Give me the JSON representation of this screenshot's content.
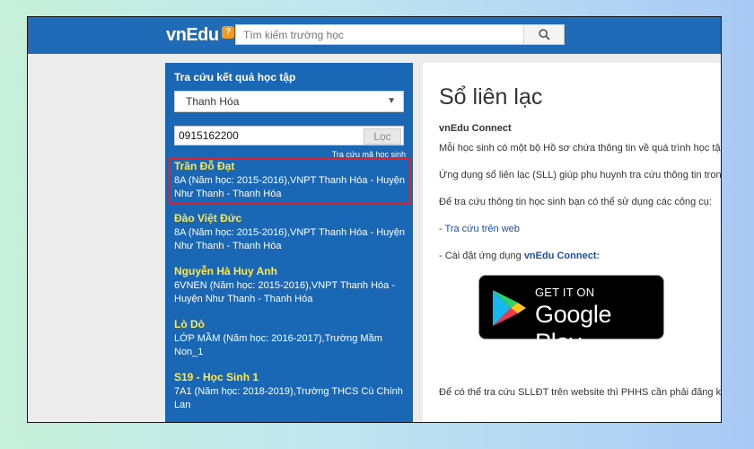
{
  "header": {
    "logo_text": "vnEdu",
    "logo_badge": "?",
    "search_placeholder": "Tìm kiếm trường học"
  },
  "sidebar": {
    "title": "Tra cứu kết quả học tập",
    "province_select": "Thanh Hóa",
    "phone_value": "0915162200",
    "search_button": "Lọc",
    "lookup_link": "Tra cứu mã học sinh",
    "results": [
      {
        "name": "Trần Đỗ Đạt",
        "line1": "8A (Năm học: 2015-2016),VNPT Thanh Hóa - Huyện",
        "line2": "Như Thanh - Thanh Hóa"
      },
      {
        "name": "Đào Việt Đức",
        "line1": "8A (Năm học: 2015-2016),VNPT Thanh Hóa - Huyện",
        "line2": "Như Thanh - Thanh Hóa"
      },
      {
        "name": "Nguyễn Hà Huy Anh",
        "line1": "6VNEN (Năm học: 2015-2016),VNPT Thanh Hóa -",
        "line2": "Huyện Như Thanh - Thanh Hóa"
      },
      {
        "name": "Lò Dò",
        "line1": "LỚP MẦM (Năm học: 2016-2017),Trường Mầm",
        "line2": "Non_1"
      },
      {
        "name": "S19 - Học Sinh 1",
        "line1": "7A1 (Năm học: 2018-2019),Trường THCS Cù Chính",
        "line2": "Lan"
      }
    ]
  },
  "main": {
    "title": "Sổ liên lạc",
    "subtitle": "vnEdu Connect",
    "para1": "Mỗi học sinh có một bộ Hồ sơ chứa thông tin về quá trình học tập",
    "para2": "Ứng dụng sổ liên lạc (SLL) giúp phụ huynh tra cứu thông tin trong",
    "para3": "Để tra cứu thông tin học sinh bạn có thể sử dụng các công cụ:",
    "link1_prefix": "- ",
    "link1": "Tra cứu trên web",
    "app_prefix": "- Cài đặt ứng dụng ",
    "app_name": "vnEdu Connect:",
    "gplay_small": "GET IT ON",
    "gplay_big": "Google Play",
    "footer": "Để có thể tra cứu SLLĐT trên website thì PHHS cần phải đăng ký"
  },
  "colors": {
    "header_blue": "#1f6bb8",
    "sidebar_blue": "#1a67b5",
    "name_yellow": "#ffe94a",
    "highlight_red": "#e0202a"
  }
}
